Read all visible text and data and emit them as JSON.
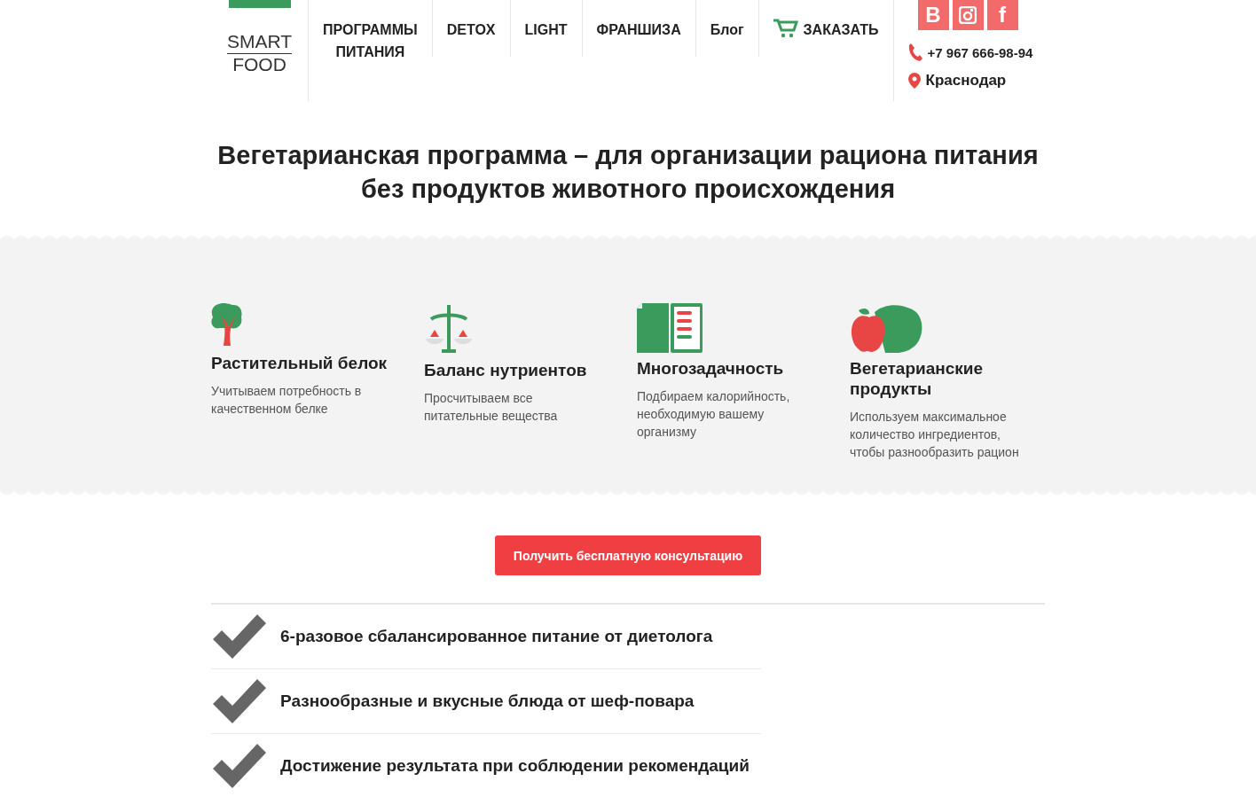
{
  "logo": {
    "line1": "SMART",
    "line2": "FOOD"
  },
  "nav": [
    {
      "label": "ПРОГРАММЫ ПИТАНИЯ",
      "kind": "text"
    },
    {
      "label": "DETOX",
      "kind": "text"
    },
    {
      "label": "LIGHT",
      "kind": "text"
    },
    {
      "label": "ФРАНШИЗА",
      "kind": "text"
    },
    {
      "label": "Блог",
      "kind": "text"
    },
    {
      "label": "ЗАКАЗАТЬ",
      "kind": "cart"
    }
  ],
  "socials": [
    {
      "kind": "text",
      "label": "В"
    },
    {
      "kind": "instagram"
    },
    {
      "kind": "text",
      "label": "f"
    }
  ],
  "phone": "+7 967 666-98-94",
  "city": "Краснодар",
  "title": "Вегетарианская программа – для организации рациона питания без продуктов животного происхождения",
  "features": [
    {
      "kind": "tree",
      "title": "Растительный белок",
      "text": "Учитываем потребность в качественном белке"
    },
    {
      "kind": "scales",
      "title": "Баланс нутриентов",
      "text": "Просчитываем все питательные вещества"
    },
    {
      "kind": "checklist",
      "title": "Многозадачность",
      "text": "Подбираем калорийность, необходимую вашему организму"
    },
    {
      "kind": "apple",
      "title": "Вегетарианские продукты",
      "text": "Используем максимальное количество ингредиентов, чтобы разнообразить рацион"
    }
  ],
  "cta": "Получить бесплатную консультацию",
  "benefits": [
    "6-разовое сбалансированное питание от диетолога",
    "Разнообразные и вкусные блюда от шеф-повара",
    "Достижение результата при соблюдении рекомендаций"
  ]
}
